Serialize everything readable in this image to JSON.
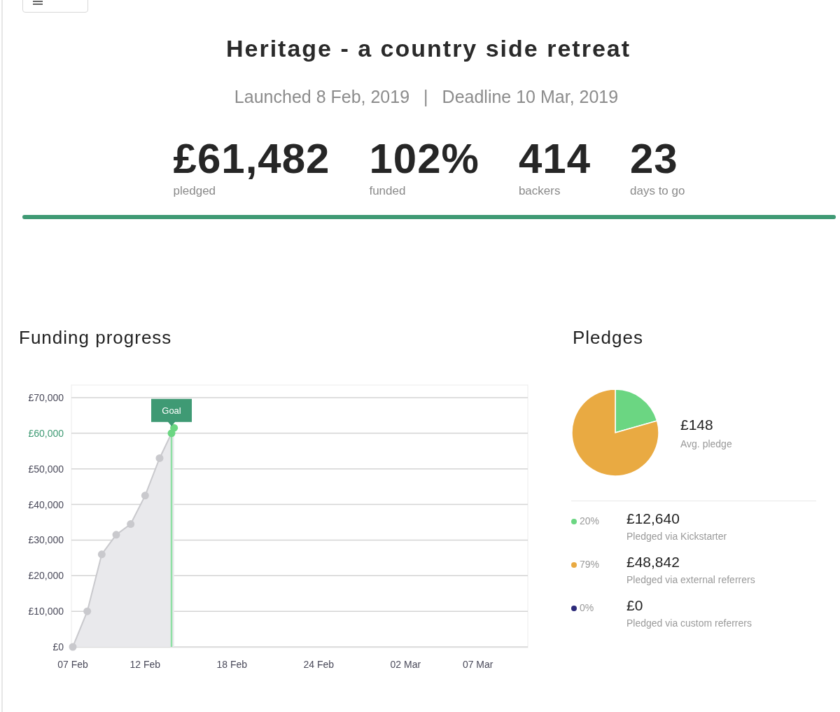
{
  "header": {
    "title": "Heritage - a country side retreat",
    "launched": "Launched 8 Feb, 2019",
    "separator": "|",
    "deadline": "Deadline 10 Mar, 2019"
  },
  "stats": [
    {
      "value": "£61,482",
      "label": "pledged"
    },
    {
      "value": "102%",
      "label": "funded"
    },
    {
      "value": "414",
      "label": "backers"
    },
    {
      "value": "23",
      "label": "days to go"
    }
  ],
  "progress": {
    "level": 1
  },
  "funding_progress": {
    "title": "Funding progress",
    "chart_data": {
      "type": "line",
      "categories": [
        "07 Feb",
        null,
        null,
        null,
        null,
        "12 Feb",
        null,
        null,
        null,
        null,
        null,
        "18 Feb",
        null,
        null,
        null,
        null,
        null,
        "24 Feb",
        null,
        null,
        null,
        null,
        null,
        "02 Mar",
        null,
        null,
        null,
        null,
        "07 Mar",
        null,
        null
      ],
      "grid": true,
      "series": [
        {
          "color": "#c9c9cd",
          "marker": "circle",
          "values": [
            0,
            10000,
            26000,
            31500,
            34500,
            42500,
            53000,
            61500,
            null,
            null,
            null,
            null,
            null,
            null,
            null,
            null,
            null,
            null,
            null,
            null,
            null,
            null,
            null,
            null,
            null,
            null,
            null,
            null,
            null,
            null,
            null
          ]
        }
      ],
      "ylim": [
        0,
        70000
      ],
      "yticks": [
        {
          "value": 0,
          "label": "£0"
        },
        {
          "value": 10000,
          "label": "£10,000"
        },
        {
          "value": 20000,
          "label": "£20,000"
        },
        {
          "value": 30000,
          "label": "£30,000"
        },
        {
          "value": 40000,
          "label": "£40,000"
        },
        {
          "value": 50000,
          "label": "£50,000"
        },
        {
          "value": 60000,
          "label": "£60,000"
        },
        {
          "value": 70000,
          "label": "£70,000"
        }
      ],
      "annotations": [
        {
          "text": "Goal",
          "y": 60000
        }
      ]
    }
  },
  "pledges": {
    "title": "Pledges",
    "average": "£148",
    "average_label": "Avg. pledge",
    "chart_data": {
      "type": "pie",
      "categories": [
        "Pledged via Kickstarter",
        "Pledged via external referrers",
        "Pledged via custom referrers"
      ],
      "values": [
        20.6,
        79.4,
        0
      ]
    },
    "breakdown": [
      {
        "color": "#6bd682",
        "percent": "20%",
        "amount": "£12,640"
      },
      {
        "color": "#e9aa42",
        "percent": "79%",
        "amount": "£48,842"
      },
      {
        "color": "#2c2a7a",
        "percent": "0%",
        "amount": "£0"
      }
    ]
  }
}
